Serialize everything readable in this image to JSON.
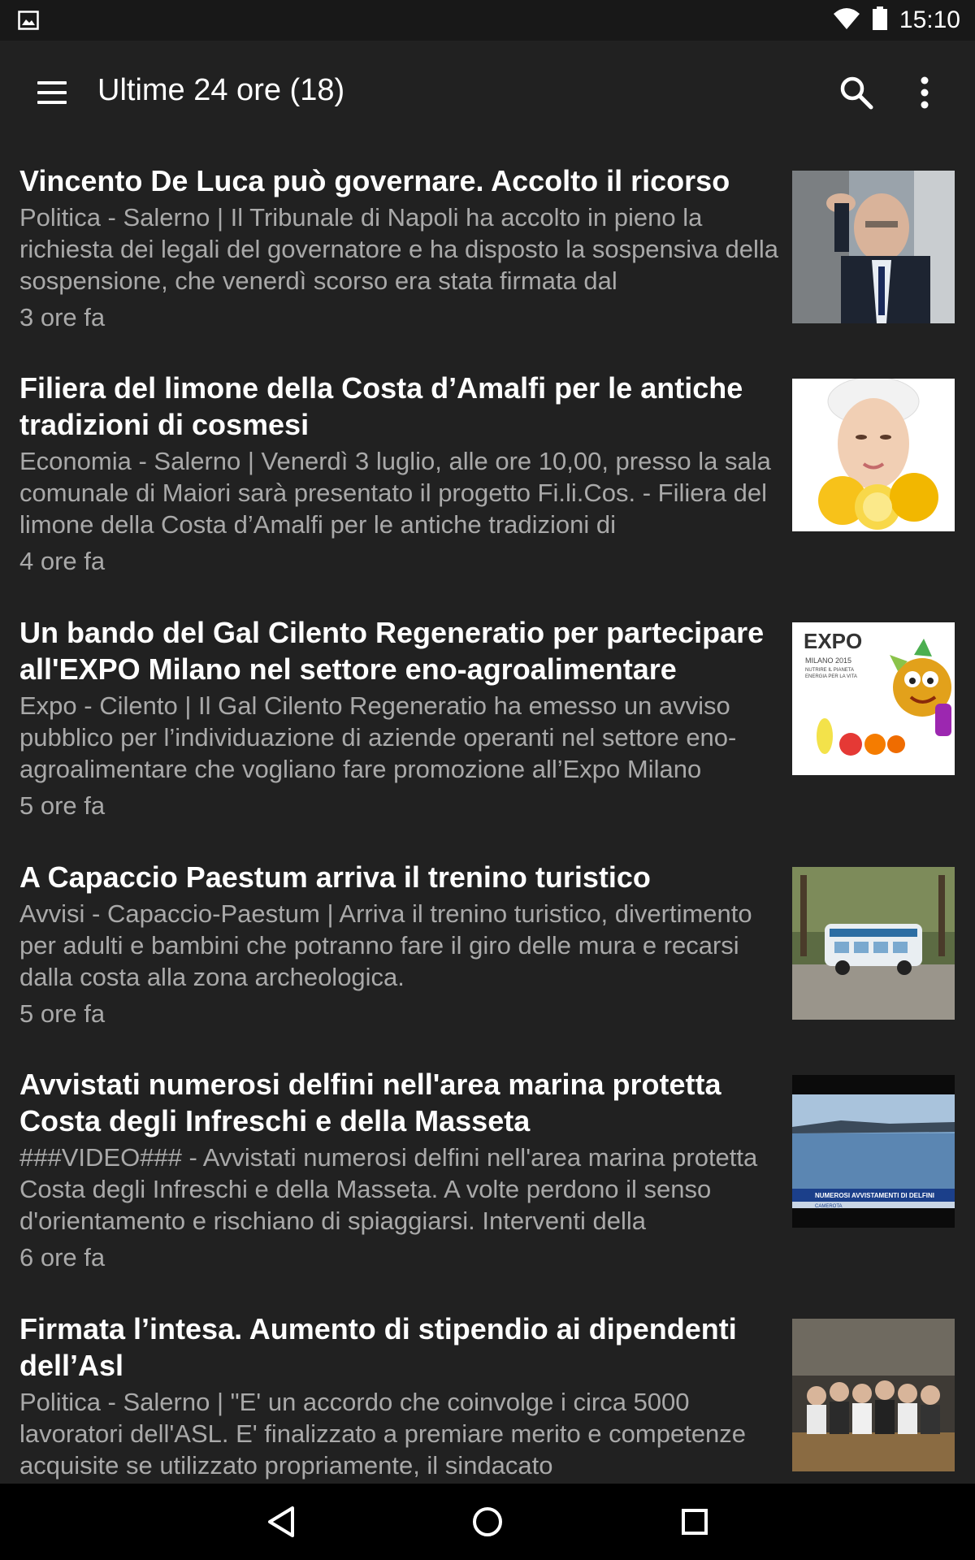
{
  "status_bar": {
    "time": "15:10",
    "icons": [
      "image-notification-icon",
      "wifi-icon",
      "battery-icon"
    ]
  },
  "app_bar": {
    "title": "Ultime 24 ore (18)",
    "icons": [
      "menu-icon",
      "search-icon",
      "more-vert-icon"
    ]
  },
  "articles": [
    {
      "title": "Vincento De Luca può governare. Accolto il ricorso",
      "summary": "Politica - Salerno | Il Tribunale di Napoli ha accolto in pieno la richiesta dei legali del governatore e ha disposto la sospensiva della sospensione, che venerdì scorso era stata firmata dal",
      "time": "3 ore fa"
    },
    {
      "title": "Filiera del limone della Costa d’Amalfi per le antiche tradizioni di cosmesi",
      "summary": "Economia - Salerno | Venerdì 3 luglio, alle ore 10,00, presso la sala comunale di Maiori sarà presentato il progetto Fi.li.Cos. - Filiera del limone della Costa d’Amalfi per le antiche tradizioni di",
      "time": "4 ore fa"
    },
    {
      "title": "Un bando del Gal Cilento Regeneratio per partecipare all'EXPO Milano nel settore eno-agroalimentare",
      "summary": "Expo - Cilento | Il Gal Cilento Regeneratio ha emesso un avviso pubblico per l’individuazione di aziende operanti nel settore eno-agroalimentare che vogliano fare promozione all’Expo Milano",
      "time": "5 ore fa",
      "image_text": [
        "EXPO",
        "MILANO 2015",
        "NUTRIRE IL PIANETA",
        "ENERGIA PER LA VITA"
      ]
    },
    {
      "title": "A Capaccio Paestum arriva il trenino turistico",
      "summary": "Avvisi - Capaccio-Paestum | Arriva il trenino turistico, divertimento per adulti e bambini che potranno fare il giro delle mura e recarsi dalla costa alla zona archeologica.",
      "time": "5 ore fa"
    },
    {
      "title": "Avvistati numerosi delfini nell'area marina protetta Costa degli Infreschi e della Masseta",
      "summary": "###VIDEO### - Avvistati numerosi delfini nell'area marina protetta Costa degli Infreschi e della Masseta. A volte perdono il senso d'orientamento e rischiano di spiaggiarsi. Interventi della",
      "time": "6 ore fa",
      "image_text": [
        "NUMEROSI AVVISTAMENTI DI DELFINI",
        "CAMEROTA"
      ]
    },
    {
      "title": "Firmata l’intesa. Aumento di stipendio ai dipendenti dell’Asl",
      "summary": "Politica - Salerno | \"E' un accordo che coinvolge i circa 5000 lavoratori dell'ASL. E' finalizzato a premiare merito e competenze acquisite se utilizzato propriamente, il sindacato",
      "time": ""
    }
  ],
  "nav_bar": {
    "icons": [
      "back-icon",
      "home-icon",
      "recents-icon"
    ]
  }
}
